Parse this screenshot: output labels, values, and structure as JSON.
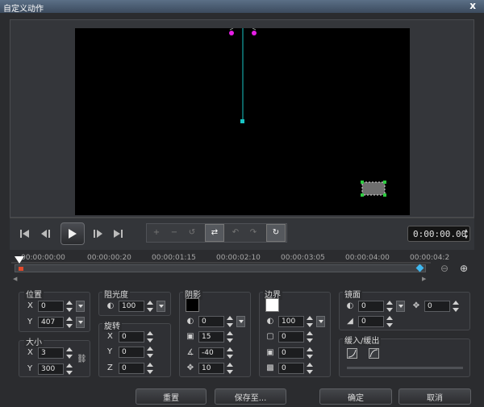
{
  "window": {
    "title": "自定义动作",
    "close": "x"
  },
  "timecode": "0:00:00.00",
  "ruler_labels": [
    "00:00:00:00",
    "00:00:00:20",
    "00:00:01:15",
    "00:00:02:10",
    "00:00:03:05",
    "00:00:04:00",
    "00:00:04:2"
  ],
  "position": {
    "label": "位置",
    "x_label": "X",
    "x": "0",
    "y_label": "Y",
    "y": "407"
  },
  "size": {
    "label": "大小",
    "x_label": "X",
    "x": "3",
    "y_label": "Y",
    "y": "300"
  },
  "opacity": {
    "label": "阻光度",
    "value": "100"
  },
  "rotation": {
    "label": "旋转",
    "x_label": "X",
    "x": "0",
    "y_label": "Y",
    "y": "0",
    "z_label": "Z",
    "z": "0"
  },
  "shadow": {
    "label": "阴影",
    "color": "#000000",
    "opacity": "0",
    "blur": "15",
    "angle": "-40",
    "distance": "10"
  },
  "border": {
    "label": "边界",
    "color": "#ffffff",
    "opacity": "100",
    "v1": "0",
    "v2": "0",
    "v3": "0"
  },
  "mirror": {
    "label": "镜面",
    "v1": "0",
    "v2": "0",
    "v3": "0"
  },
  "easing": {
    "label": "缓入/缓出"
  },
  "buttons": {
    "reset": "重置",
    "save_to": "保存至...",
    "ok": "确定",
    "cancel": "取消"
  },
  "colors": {
    "cyan": "#19c5c5",
    "magenta": "#e61ee6",
    "green": "#2ecc40"
  }
}
